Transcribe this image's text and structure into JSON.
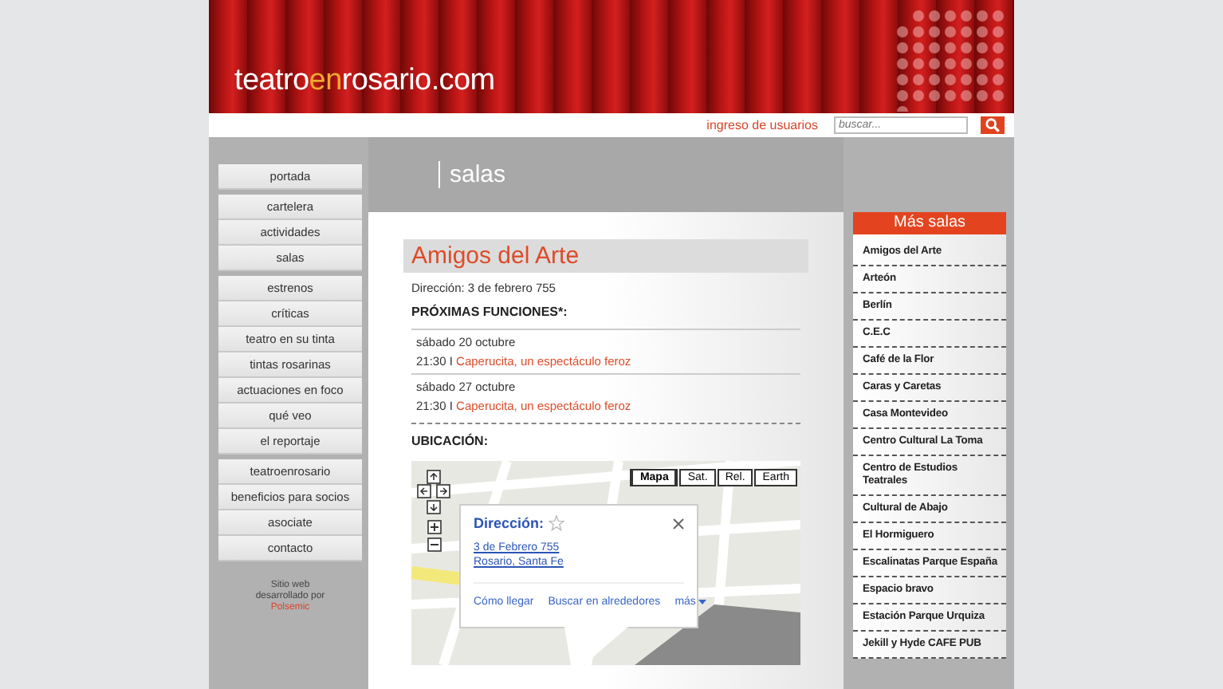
{
  "header": {
    "logo": {
      "before": "teatro",
      "highlight": "en",
      "after": "rosario.com"
    }
  },
  "topbar": {
    "login_link": "ingreso de usuarios",
    "search": {
      "placeholder": "buscar..."
    }
  },
  "nav": {
    "groups": [
      [
        "portada"
      ],
      [
        "cartelera",
        "actividades",
        "salas"
      ],
      [
        "estrenos",
        "críticas",
        "teatro en su tinta",
        "tintas rosarinas",
        "actuaciones en foco",
        "qué veo",
        "el reportaje"
      ],
      [
        "teatroenrosario",
        "beneficios para socios",
        "asociate",
        "contacto"
      ]
    ]
  },
  "credit": {
    "lines": [
      "Sitio web",
      "desarrollado por"
    ],
    "link": "Polsemic"
  },
  "section_title": "salas",
  "venue": {
    "name": "Amigos del Arte",
    "address": "Dirección: 3 de febrero 755",
    "functions_title": "PRÓXIMAS FUNCIONES*:",
    "functions": [
      {
        "date": "sábado 20 octubre",
        "time": "21:30 I",
        "title": "Caperucita, un espectáculo feroz"
      },
      {
        "date": "sábado 27 octubre",
        "time": "21:30 I",
        "title": "Caperucita, un espectáculo feroz"
      }
    ],
    "location_title": "UBICACIÓN:",
    "map": {
      "map_types": [
        {
          "label": "Mapa",
          "selected": true
        },
        {
          "label": "Sat.",
          "selected": false
        },
        {
          "label": "Rel.",
          "selected": false
        },
        {
          "label": "Earth",
          "selected": false
        }
      ],
      "popup": {
        "title": "Dirección:",
        "address_lines": [
          "3 de Febrero 755",
          "Rosario, Santa Fe"
        ],
        "actions": [
          "Cómo llegar",
          "Buscar en alrededores",
          "más"
        ]
      }
    }
  },
  "sidebar": {
    "title": "Más salas",
    "items": [
      "Amigos del Arte",
      "Arteón",
      "Berlín",
      "C.E.C",
      "Café de la Flor",
      "Caras y Caretas",
      "Casa Montevideo",
      "Centro Cultural La Toma",
      "Centro de Estudios Teatrales",
      "Cultural de Abajo",
      "El Hormiguero",
      "Escalinatas Parque España",
      "Espacio bravo",
      "Estación Parque Urquiza",
      "Jekill y Hyde CAFE PUB"
    ]
  }
}
